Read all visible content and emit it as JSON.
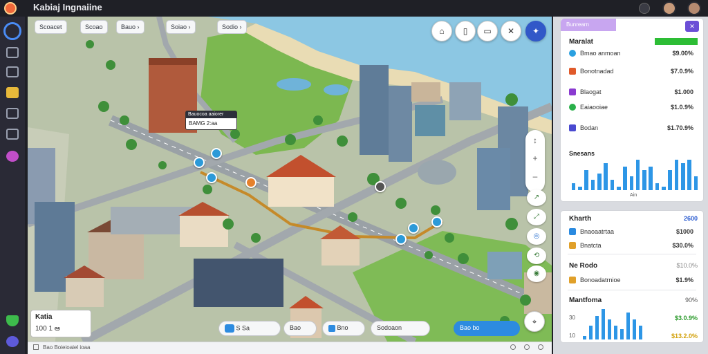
{
  "titlebar": {
    "app_title": "Kabiaj Ingnaiine"
  },
  "top_chips": [
    "Scoacet",
    "Scoao",
    "Bauo",
    "Soiao",
    "Sodio"
  ],
  "map": {
    "callout": {
      "header": "Bauocoa aaiorer",
      "body": "BAMG 2:aa"
    },
    "zoom_controls": [
      "+",
      "–"
    ],
    "right_controls": [
      "↗",
      "⤢",
      "◎",
      "⟲"
    ],
    "mini_card": {
      "title": "Katia",
      "stats": "100 1 ఆ"
    },
    "bottom_toolbar": [
      {
        "label": "S  Sa"
      },
      {
        "label": "Bao"
      },
      {
        "label": "Bno"
      },
      {
        "label": "Sodoaon"
      },
      {
        "label": "Bao  bo"
      }
    ]
  },
  "statusbar": {
    "text": "Bao Boieioaiel ioaa"
  },
  "sidebar": {
    "badge": "Bunrearn",
    "panel1": {
      "title": "Maralat",
      "title_value": "",
      "rows": [
        {
          "label": "Bmao anmoan",
          "value": "$9.00%",
          "color": "#2aa0e0"
        },
        {
          "label": "Bonotnadad",
          "value": "$7.0.9%",
          "color": "#e05a2a"
        },
        {
          "label": "Blaogat",
          "value": "$1.000",
          "color": "#8a3ad0"
        },
        {
          "label": "Eaiaooiae",
          "value": "$1.0.9%",
          "color": "#2ab04a"
        },
        {
          "label": "Bodan",
          "value": "$1.70.9%",
          "color": "#4a4ad0"
        }
      ],
      "chart_title": "Snesans",
      "chart_xlabel": "Ain"
    },
    "panel2": {
      "title": "Kharth",
      "title_value": "2600",
      "rows": [
        {
          "label": "Bnaoaatrtaa",
          "value": "$1000",
          "color": "#2a8ae0"
        },
        {
          "label": "Bnatcta",
          "value": "$30.0%",
          "color": "#e0a02a"
        }
      ]
    },
    "panel3": {
      "title": "Ne Rodo",
      "title_value": "$10.0%",
      "rows": [
        {
          "label": "Bonoadatrnioe",
          "value": "$1.9%",
          "color": "#e0a02a"
        }
      ]
    },
    "panel4": {
      "title": "Mantfoma",
      "title_value": "90%",
      "rows": [
        {
          "label": "30",
          "value": "$3.0.9%",
          "color": "#fff"
        },
        {
          "label": "10",
          "value": "$13.2.0%",
          "color": "#fff"
        }
      ]
    }
  },
  "chart_data": [
    {
      "type": "bar",
      "title": "Snesans",
      "xlabel": "Ain",
      "values": [
        2,
        1,
        6,
        3,
        5,
        8,
        3,
        1,
        7,
        4,
        9,
        6,
        7,
        2,
        1,
        6,
        9,
        8,
        9,
        4
      ]
    },
    {
      "type": "bar",
      "title": "Mantfoma",
      "values": [
        1,
        4,
        7,
        9,
        6,
        4,
        3,
        8,
        6,
        4
      ]
    }
  ]
}
